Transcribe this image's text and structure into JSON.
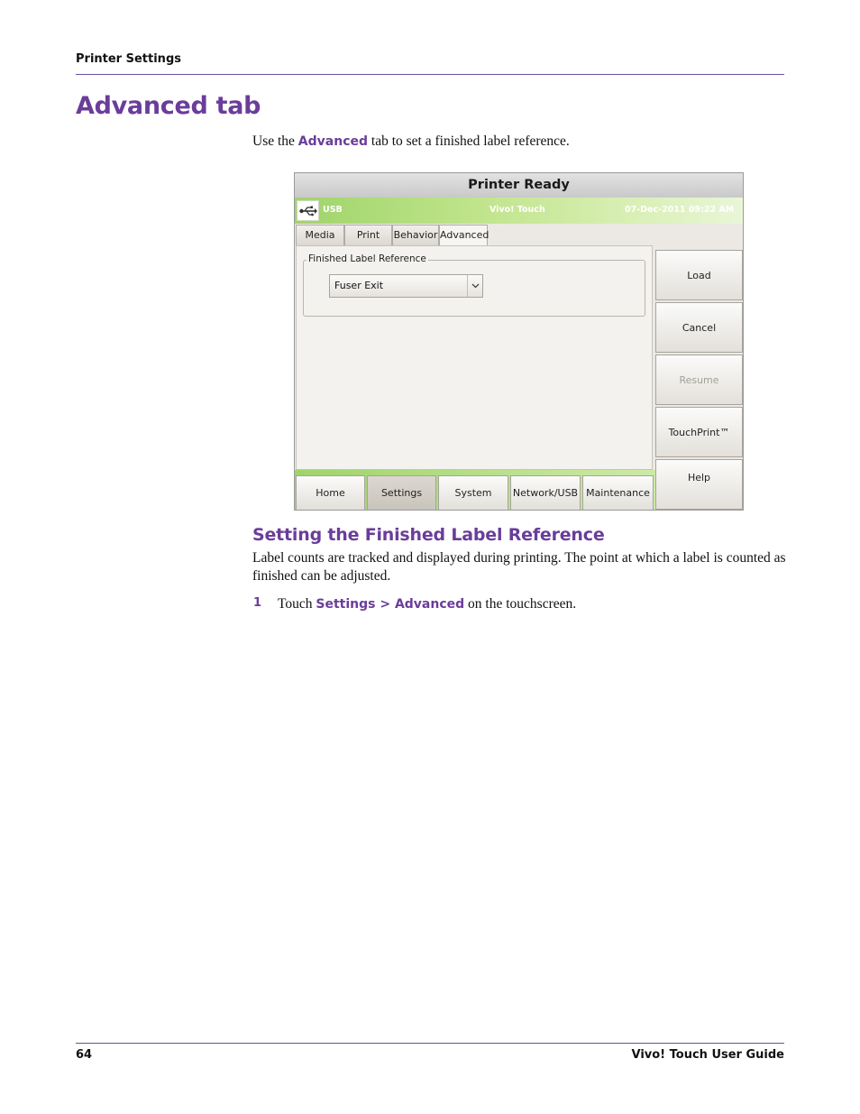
{
  "header": {
    "running_title": "Printer Settings"
  },
  "section": {
    "title": "Advanced tab",
    "intro_before": "Use the ",
    "intro_keyword": "Advanced",
    "intro_after": " tab to set a finished label reference."
  },
  "screen": {
    "title": "Printer Ready",
    "status": {
      "connection": "USB",
      "device": "Vivo! Touch",
      "datetime": "07-Dec-2011 09:22 AM"
    },
    "icons": {
      "usb": "usb-icon",
      "dropdown": "chevron-down-icon"
    },
    "tabs": [
      "Media",
      "Print",
      "Behavior",
      "Advanced"
    ],
    "active_tab": "Advanced",
    "group_label": "Finished Label Reference",
    "select_value": "Fuser Exit",
    "side_buttons": [
      "Load",
      "Cancel",
      "Resume",
      "TouchPrint™",
      "Help"
    ],
    "disabled_button": "Resume",
    "nav_buttons": [
      "Home",
      "Settings",
      "System",
      "Network/USB",
      "Maintenance"
    ],
    "active_nav": "Settings",
    "colors": {
      "accent_green": "#9fd46a",
      "heading_purple": "#6a3d9a"
    }
  },
  "subsection": {
    "title": "Setting the Finished Label Reference",
    "body": "Label counts are tracked and displayed during printing. The point at which a label is counted as finished can be adjusted."
  },
  "steps": [
    {
      "number": "1",
      "before": "Touch ",
      "keyword": "Settings > Advanced",
      "after": " on the touchscreen."
    }
  ],
  "footer": {
    "page_number": "64",
    "guide_title": "Vivo! Touch User Guide"
  }
}
